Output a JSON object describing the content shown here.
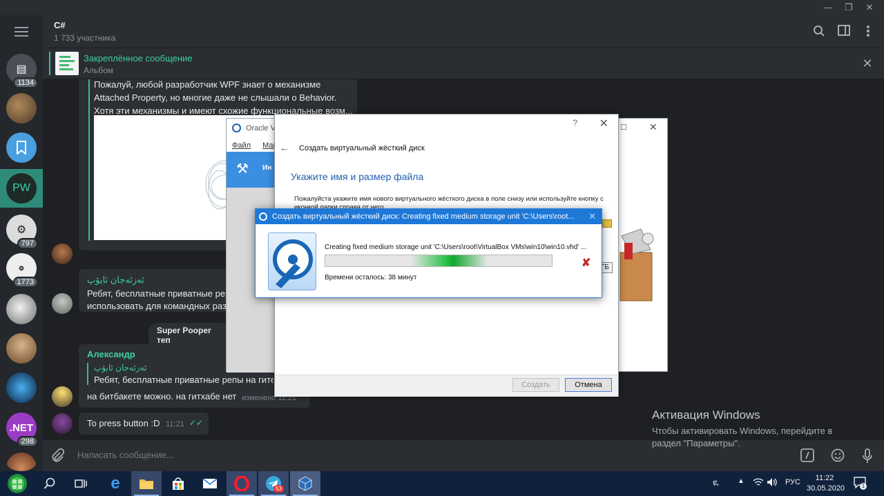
{
  "window": {
    "controls": [
      "—",
      "❐",
      "✕"
    ]
  },
  "chat": {
    "title": "C#",
    "members": "1 733 участника"
  },
  "pinned": {
    "title": "Закреплённое сообщение",
    "subtitle": "Альбом"
  },
  "sidebar": {
    "badges": [
      "1134",
      "797",
      "1773",
      "298"
    ],
    "pw_label": "PW",
    "net_label": ".NET"
  },
  "messages": {
    "m1_lines": [
      "Пожалуй, любой разработчик WPF знает о механизме",
      "Attached Property, но многие даже не слышали о Behavior.",
      "Хотя эти механизмы и имеют схожие функциональные возм..."
    ],
    "m2_author": "ئەزئەجان ئايۆپ",
    "m2_lines": [
      "Ребят, бесплатные приватные репо",
      "использовать для командных разр"
    ],
    "service": "Super Pooper теп",
    "m3_author": "Александр",
    "m3_quote_author": "ئەزئەجان ئايۆپ",
    "m3_quote_text": "Ребят, бесплатные приватные репы на гите м",
    "m3_text": "на битбакете можно. на гитхабе нет",
    "m3_time": "изменено 11:21",
    "m4_text": "To press button :D",
    "m4_time": "11:21"
  },
  "composer": {
    "placeholder": "Написать сообщение..."
  },
  "activation": {
    "title": "Активация Windows",
    "line1": "Чтобы активировать Windows, перейдите в",
    "line2": "раздел \"Параметры\"."
  },
  "vbox_manager": {
    "title": "Oracle VI",
    "menu_file": "Файл",
    "menu_machine": "Маш",
    "tool_label": "Ин"
  },
  "create_dialog": {
    "help": "?",
    "caption": "Создать виртуальный жёсткий диск",
    "heading": "Укажите имя и размер файла",
    "text": "Пожалуйста укажите имя нового виртуального жёсткого диска в поле снизу или используйте кнопку с иконкой папки справа от него.",
    "size_unit": "ГБ",
    "create_btn": "Создать",
    "cancel_btn": "Отмена"
  },
  "progress_dialog": {
    "title": "Создать виртуальный жёсткий диск: Creating fixed medium storage unit 'C:\\Users\\root...",
    "line": "Creating fixed medium storage unit 'C:\\Users\\root\\VirtualBox VMs\\win10\\win10.vhd' ...",
    "remaining": "Времени осталось: 38 минут",
    "progress_percent": 55
  },
  "taskbar": {
    "lang": "РУС",
    "time": "11:22",
    "date": "30.05.2020",
    "telegram_badge": "53",
    "notifications": "1"
  },
  "colors": {
    "accent_green": "#3fb897",
    "dialog_blue": "#1e78d8",
    "taskbar": "#10213c"
  }
}
